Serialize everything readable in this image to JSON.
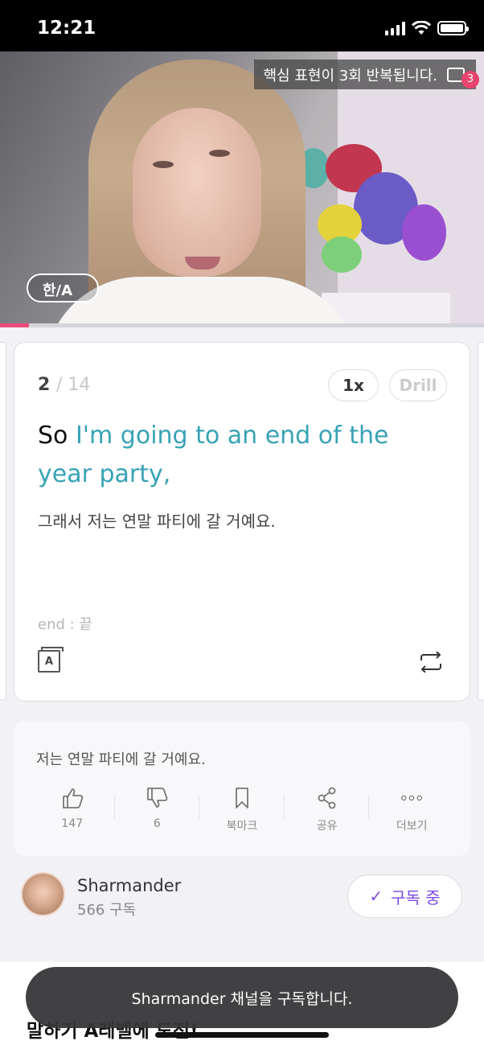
{
  "status_bar": {
    "time": "12:21"
  },
  "video": {
    "repeat_notice": "핵심 표현이 3회 반복됩니다.",
    "repeat_count": "3",
    "language_toggle": "한/A",
    "progress_fraction": 0.06
  },
  "card": {
    "current": "2",
    "total": "/ 14",
    "speed": "1x",
    "drill": "Drill",
    "sentence_prefix": "So ",
    "sentence_highlight": "I'm going to an end of the year party,",
    "translation": "그래서 저는 연말 파티에 갈 거예요.",
    "vocab": "end : 끝",
    "dictionary_letter": "A"
  },
  "actions": {
    "sentence": "저는 연말 파티에 갈 거예요.",
    "like_count": "147",
    "dislike_count": "6",
    "bookmark_label": "북마크",
    "share_label": "공유",
    "more_label": "더보기"
  },
  "channel": {
    "name": "Sharmander",
    "subscribers": "566 구독",
    "subscribe_label": "구독 중",
    "check_mark": "✓"
  },
  "bottom": {
    "section_title": "말하기 A레벨에 도전!",
    "toast": "Sharmander 채널을 구독합니다."
  },
  "colors": {
    "highlight": "#38a3b5",
    "accent_pink": "#ea4d7a",
    "subscribe_purple": "#7b49e0"
  }
}
